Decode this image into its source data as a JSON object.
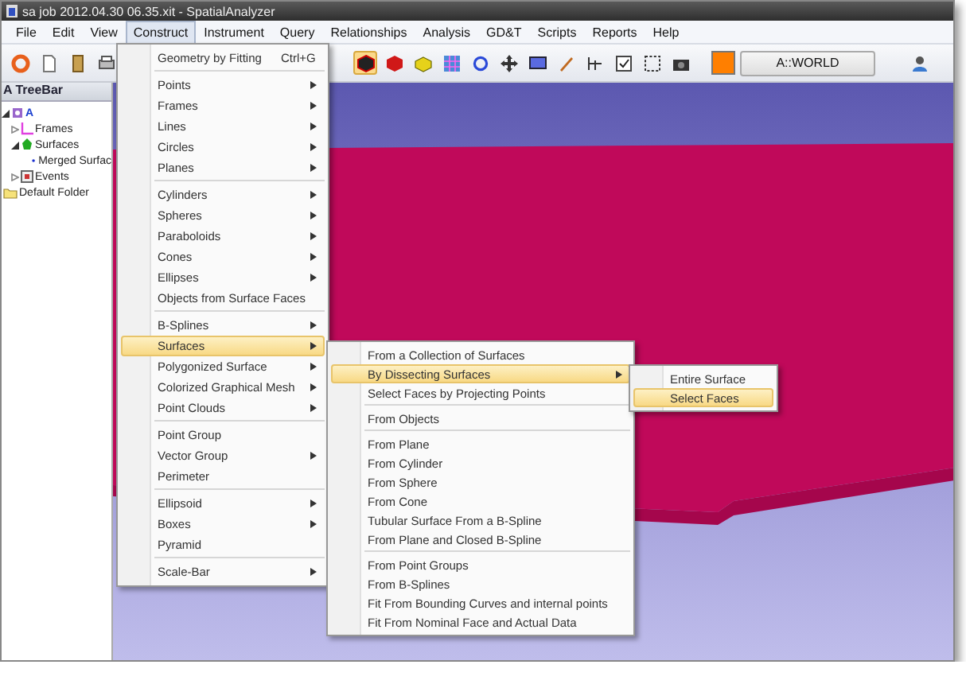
{
  "title_bar": {
    "title": "sa job 2012.04.30 06.35.xit - SpatialAnalyzer"
  },
  "menu_bar": [
    {
      "label": "File",
      "selected": false
    },
    {
      "label": "Edit",
      "selected": false
    },
    {
      "label": "View",
      "selected": false
    },
    {
      "label": "Construct",
      "selected": true
    },
    {
      "label": "Instrument",
      "selected": false
    },
    {
      "label": "Query",
      "selected": false
    },
    {
      "label": "Relationships",
      "selected": false
    },
    {
      "label": "Analysis",
      "selected": false
    },
    {
      "label": "GD&T",
      "selected": false
    },
    {
      "label": "Scripts",
      "selected": false
    },
    {
      "label": "Reports",
      "selected": false
    },
    {
      "label": "Help",
      "selected": false
    }
  ],
  "toolbar": {
    "frame_field": "A::WORLD"
  },
  "tree": {
    "header": "A TreeBar",
    "items": [
      {
        "label": "A",
        "kind": "instrument",
        "expanded": true,
        "children": [
          {
            "label": "Frames",
            "kind": "frames",
            "expanded": false
          },
          {
            "label": "Surfaces",
            "kind": "surfaces",
            "expanded": true,
            "children": [
              {
                "label": "Merged Surfac",
                "kind": "surface"
              }
            ]
          },
          {
            "label": "Events",
            "kind": "events",
            "expanded": false
          }
        ]
      },
      {
        "label": "Default Folder",
        "kind": "folder"
      }
    ]
  },
  "construct_menu": {
    "groups": [
      [
        {
          "label": "Geometry by Fitting",
          "shortcut": "Ctrl+G",
          "submenu": false,
          "selected": false
        }
      ],
      [
        {
          "label": "Points",
          "submenu": true,
          "selected": false
        },
        {
          "label": "Frames",
          "submenu": true,
          "selected": false
        },
        {
          "label": "Lines",
          "submenu": true,
          "selected": false
        },
        {
          "label": "Circles",
          "submenu": true,
          "selected": false
        },
        {
          "label": "Planes",
          "submenu": true,
          "selected": false
        }
      ],
      [
        {
          "label": "Cylinders",
          "submenu": true,
          "selected": false
        },
        {
          "label": "Spheres",
          "submenu": true,
          "selected": false
        },
        {
          "label": "Paraboloids",
          "submenu": true,
          "selected": false
        },
        {
          "label": "Cones",
          "submenu": true,
          "selected": false
        },
        {
          "label": "Ellipses",
          "submenu": true,
          "selected": false
        },
        {
          "label": "Objects from Surface Faces",
          "submenu": false,
          "selected": false
        }
      ],
      [
        {
          "label": "B-Splines",
          "submenu": true,
          "selected": false
        },
        {
          "label": "Surfaces",
          "submenu": true,
          "selected": true
        },
        {
          "label": "Polygonized Surface",
          "submenu": true,
          "selected": false
        },
        {
          "label": "Colorized Graphical Mesh",
          "submenu": true,
          "selected": false
        },
        {
          "label": "Point Clouds",
          "submenu": true,
          "selected": false
        }
      ],
      [
        {
          "label": "Point Group",
          "submenu": false,
          "selected": false
        },
        {
          "label": "Vector Group",
          "submenu": true,
          "selected": false
        },
        {
          "label": "Perimeter",
          "submenu": false,
          "selected": false
        }
      ],
      [
        {
          "label": "Ellipsoid",
          "submenu": true,
          "selected": false
        },
        {
          "label": "Boxes",
          "submenu": true,
          "selected": false
        },
        {
          "label": "Pyramid",
          "submenu": false,
          "selected": false
        }
      ],
      [
        {
          "label": "Scale-Bar",
          "submenu": true,
          "selected": false
        }
      ]
    ]
  },
  "surfaces_submenu": {
    "groups": [
      [
        {
          "label": "From a Collection of Surfaces",
          "submenu": false,
          "selected": false
        },
        {
          "label": "By Dissecting Surfaces",
          "submenu": true,
          "selected": true
        },
        {
          "label": "Select Faces by Projecting Points",
          "submenu": false,
          "selected": false
        }
      ],
      [
        {
          "label": "From Objects",
          "submenu": false,
          "selected": false
        }
      ],
      [
        {
          "label": "From Plane",
          "submenu": false,
          "selected": false
        },
        {
          "label": "From Cylinder",
          "submenu": false,
          "selected": false
        },
        {
          "label": "From Sphere",
          "submenu": false,
          "selected": false
        },
        {
          "label": "From Cone",
          "submenu": false,
          "selected": false
        },
        {
          "label": "Tubular Surface From a B-Spline",
          "submenu": false,
          "selected": false
        },
        {
          "label": "From Plane and Closed B-Spline",
          "submenu": false,
          "selected": false
        }
      ],
      [
        {
          "label": "From Point Groups",
          "submenu": false,
          "selected": false
        },
        {
          "label": "From B-Splines",
          "submenu": false,
          "selected": false
        },
        {
          "label": "Fit From Bounding Curves and internal points",
          "submenu": false,
          "selected": false
        },
        {
          "label": "Fit From Nominal Face and Actual Data",
          "submenu": false,
          "selected": false
        }
      ]
    ]
  },
  "dissect_submenu": {
    "groups": [
      [
        {
          "label": "Entire Surface",
          "submenu": false,
          "selected": false
        },
        {
          "label": "Select Faces",
          "submenu": false,
          "selected": true
        }
      ]
    ]
  }
}
